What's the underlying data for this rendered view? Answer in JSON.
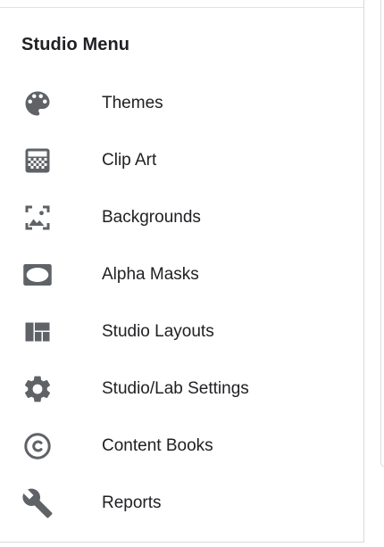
{
  "menu": {
    "title": "Studio Menu",
    "items": [
      {
        "label": "Themes",
        "icon": "palette-icon"
      },
      {
        "label": "Clip Art",
        "icon": "checkerboard-image-icon"
      },
      {
        "label": "Backgrounds",
        "icon": "framed-image-icon"
      },
      {
        "label": "Alpha Masks",
        "icon": "rounded-mask-icon"
      },
      {
        "label": "Studio Layouts",
        "icon": "layout-grid-icon"
      },
      {
        "label": "Studio/Lab Settings",
        "icon": "gear-icon"
      },
      {
        "label": "Content Books",
        "icon": "copyright-icon"
      },
      {
        "label": "Reports",
        "icon": "wrench-icon"
      }
    ]
  },
  "colors": {
    "icon": "#5f6368",
    "text": "#202124",
    "border": "#d9d9d9"
  }
}
